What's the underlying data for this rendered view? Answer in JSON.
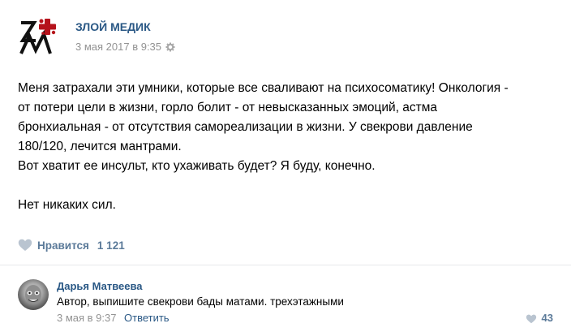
{
  "post": {
    "author": "ЗЛОЙ МЕДИК",
    "date": "3 мая 2017 в 9:35",
    "text_lines": [
      "Меня затрахали эти умники, которые все сваливают на психосоматику! Онкология -",
      "от потери цели в жизни, горло болит - от невысказанных эмоций, астма",
      "бронхиальная - от отсутствия самореализации в жизни. У свекрови давление",
      "180/120, лечится мантрами.",
      "Вот хватит ее инсульт, кто ухаживать будет? Я буду, конечно."
    ],
    "closing_line": "Нет никаких сил.",
    "like_label": "Нравится",
    "like_count": "1 121",
    "logo_text": "ЗМ"
  },
  "comment": {
    "author": "Дарья Матвеева",
    "text": "Автор, выпишите свекрови бады матами. трехэтажными",
    "date": "3 мая в 9:37",
    "reply_label": "Ответить",
    "like_count": "43"
  },
  "colors": {
    "link": "#2a5885",
    "muted": "#939393",
    "like": "#5b7a99",
    "logo_accent": "#b5121b"
  },
  "icons": {
    "gear": "gear-icon",
    "heart": "heart-icon",
    "comment_heart": "heart-icon"
  }
}
